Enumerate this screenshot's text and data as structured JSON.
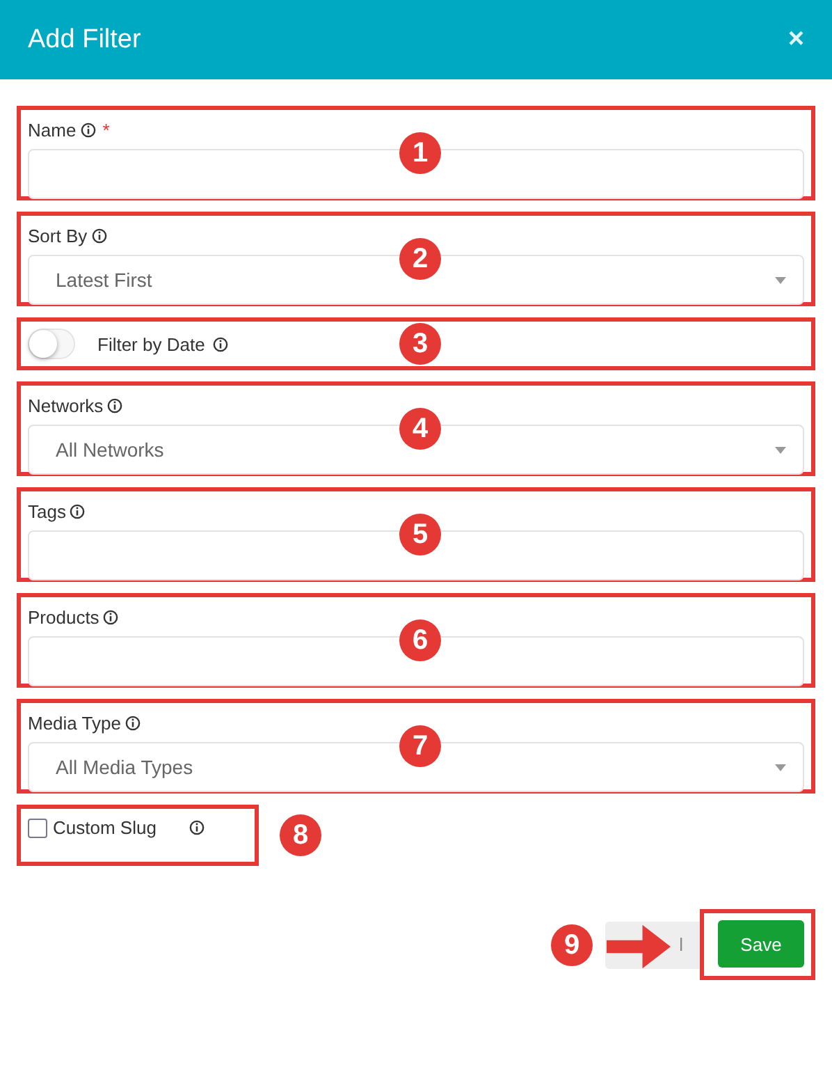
{
  "dialog": {
    "title": "Add Filter",
    "close": "×"
  },
  "fields": [
    {
      "kind": "text",
      "label": "Name",
      "required_mark": "*",
      "marker": "1"
    },
    {
      "kind": "select",
      "label": "Sort By",
      "value": "Latest First",
      "marker": "2"
    },
    {
      "kind": "toggle",
      "label": "Filter by Date",
      "on": false,
      "marker": "3"
    },
    {
      "kind": "select",
      "label": "Networks",
      "value": "All Networks",
      "marker": "4"
    },
    {
      "kind": "text",
      "label": "Tags",
      "marker": "5"
    },
    {
      "kind": "text",
      "label": "Products",
      "marker": "6"
    },
    {
      "kind": "select",
      "label": "Media Type",
      "value": "All Media Types",
      "marker": "7"
    },
    {
      "kind": "checkbox",
      "label": "Custom Slug",
      "checked": false,
      "marker": "8"
    }
  ],
  "footer": {
    "marker": "9",
    "buttons": [
      {
        "kind": "cancel",
        "label": "l"
      },
      {
        "kind": "save",
        "label": "Save"
      }
    ]
  }
}
